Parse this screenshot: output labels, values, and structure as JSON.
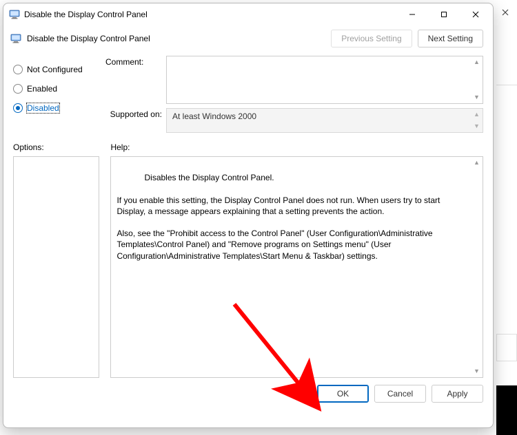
{
  "window": {
    "title": "Disable the Display Control Panel",
    "policy_title": "Disable the Display Control Panel"
  },
  "nav": {
    "previous": "Previous Setting",
    "next": "Next Setting"
  },
  "radios": {
    "not_configured": "Not Configured",
    "enabled": "Enabled",
    "disabled": "Disabled",
    "selected": "disabled"
  },
  "labels": {
    "comment": "Comment:",
    "supported_on": "Supported on:",
    "options": "Options:",
    "help": "Help:"
  },
  "supported_on_text": "At least Windows 2000",
  "help_text": "Disables the Display Control Panel.\n\nIf you enable this setting, the Display Control Panel does not run. When users try to start Display, a message appears explaining that a setting prevents the action.\n\nAlso, see the \"Prohibit access to the Control Panel\" (User Configuration\\Administrative Templates\\Control Panel) and \"Remove programs on Settings menu\" (User Configuration\\Administrative Templates\\Start Menu & Taskbar) settings.",
  "buttons": {
    "ok": "OK",
    "cancel": "Cancel",
    "apply": "Apply"
  }
}
